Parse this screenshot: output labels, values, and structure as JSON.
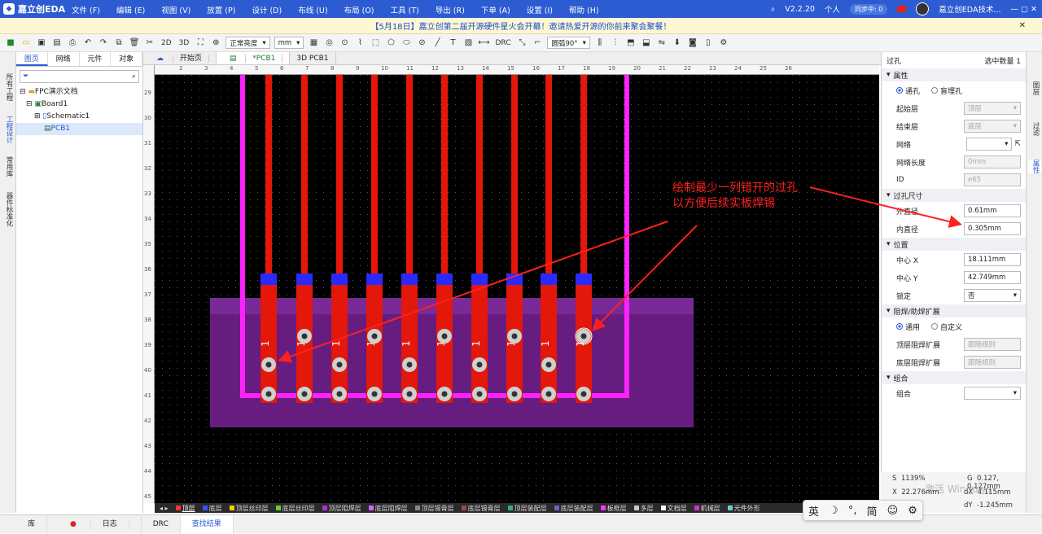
{
  "app": {
    "logo": "嘉立创EDA",
    "menu": [
      "文件 (F)",
      "编辑 (E)",
      "视图 (V)",
      "放置 (P)",
      "设计 (D)",
      "布线 (U)",
      "布局 (O)",
      "工具 (T)",
      "导出 (R)",
      "下单 (A)",
      "设置 (I)",
      "帮助 (H)"
    ],
    "version": "V2.2.20",
    "personal": "个人",
    "sync": "同步中: 0",
    "user": "嘉立创EDA技术..."
  },
  "banner": {
    "text": "【5月18日】嘉立创第二届开源硬件星火会开幕！邀请热爱开源的你前来聚会聚餐！",
    "close": "✕"
  },
  "toolbar": {
    "2d": "2D",
    "3d": "3D",
    "brightness": "正常亮度",
    "unit": "mm",
    "drc": "DRC",
    "angle": "圆弧90°"
  },
  "left_tabs": [
    "所有工程",
    "工程设计",
    "常用库",
    "器件标准化"
  ],
  "panel": {
    "tabs": [
      "图页",
      "网络",
      "元件",
      "对象"
    ],
    "tree": [
      "FPC演示文档",
      "Board1",
      "Schematic1",
      "PCB1"
    ]
  },
  "doc_tabs": [
    "开始页",
    "*PCB1",
    "3D PCB1"
  ],
  "annotation": {
    "line1": "绘制最少一列错开的过孔",
    "line2": "以方便后续实板焊锡"
  },
  "pad_label": "1",
  "layers": [
    "顶层",
    "底层",
    "顶层丝印层",
    "底层丝印层",
    "顶层阻焊层",
    "底层阻焊层",
    "顶层锡膏层",
    "底层锡膏层",
    "顶层装配层",
    "底层装配层",
    "板框层",
    "多层",
    "文档层",
    "机械层",
    "元件外形"
  ],
  "layer_colors": [
    "#ff3333",
    "#3355ff",
    "#ffcc00",
    "#66cc33",
    "#aa33cc",
    "#cc66ff",
    "#888888",
    "#aa4444",
    "#33aa88",
    "#6666cc",
    "#ff33ff",
    "#cccccc",
    "#ffffff",
    "#cc33cc",
    "#66cccc"
  ],
  "props": {
    "title": "过孔",
    "selected": "选中数量",
    "count": "1",
    "sec_attr": "属性",
    "via_type1": "通孔",
    "via_type2": "盲埋孔",
    "start_layer": "起始层",
    "start_val": "顶层",
    "end_layer": "结束层",
    "end_val": "底层",
    "net": "网络",
    "net_len": "网络长度",
    "net_len_val": "0mm",
    "id": "ID",
    "id_val": "e65",
    "sec_size": "过孔尺寸",
    "outer": "外直径",
    "outer_val": "0.61mm",
    "inner": "内直径",
    "inner_val": "0.305mm",
    "sec_pos": "位置",
    "cx": "中心 X",
    "cx_val": "18.111mm",
    "cy": "中心 Y",
    "cy_val": "42.749mm",
    "lock": "锁定",
    "lock_val": "否",
    "sec_mask": "阻焊/助焊扩展",
    "mask1": "通用",
    "mask2": "自定义",
    "top_mask": "顶层阻焊扩展",
    "bot_mask": "底层阻焊扩展",
    "rule": "跟随规则",
    "sec_group": "组合",
    "group": "组合"
  },
  "right_tabs": [
    "图层",
    "过滤",
    "属性"
  ],
  "status": {
    "s": "S",
    "s_val": "1139%",
    "g": "G",
    "g_val": "0.127, 0.127mm",
    "x": "X",
    "x_val": "22.276mm",
    "dx": "dX",
    "dx_val": "4.115mm",
    "dy": "dY",
    "dy_val": "-1.245mm",
    "watermark": "激活 Windows"
  },
  "bottom_tabs": [
    "库",
    "日志",
    "DRC",
    "查找结果"
  ],
  "ime": [
    "英",
    "☽",
    "°,",
    "简",
    "☺",
    "⚙"
  ],
  "ruler_h": [
    "2",
    "3",
    "4",
    "5",
    "6",
    "7",
    "8",
    "9",
    "10",
    "11",
    "12",
    "13",
    "14",
    "15",
    "16",
    "17",
    "18",
    "19",
    "20",
    "21",
    "22",
    "23",
    "24",
    "25",
    "26"
  ],
  "ruler_v": [
    "29",
    "30",
    "31",
    "32",
    "33",
    "34",
    "35",
    "36",
    "37",
    "38",
    "39",
    "40",
    "41",
    "42",
    "43",
    "44",
    "45"
  ]
}
